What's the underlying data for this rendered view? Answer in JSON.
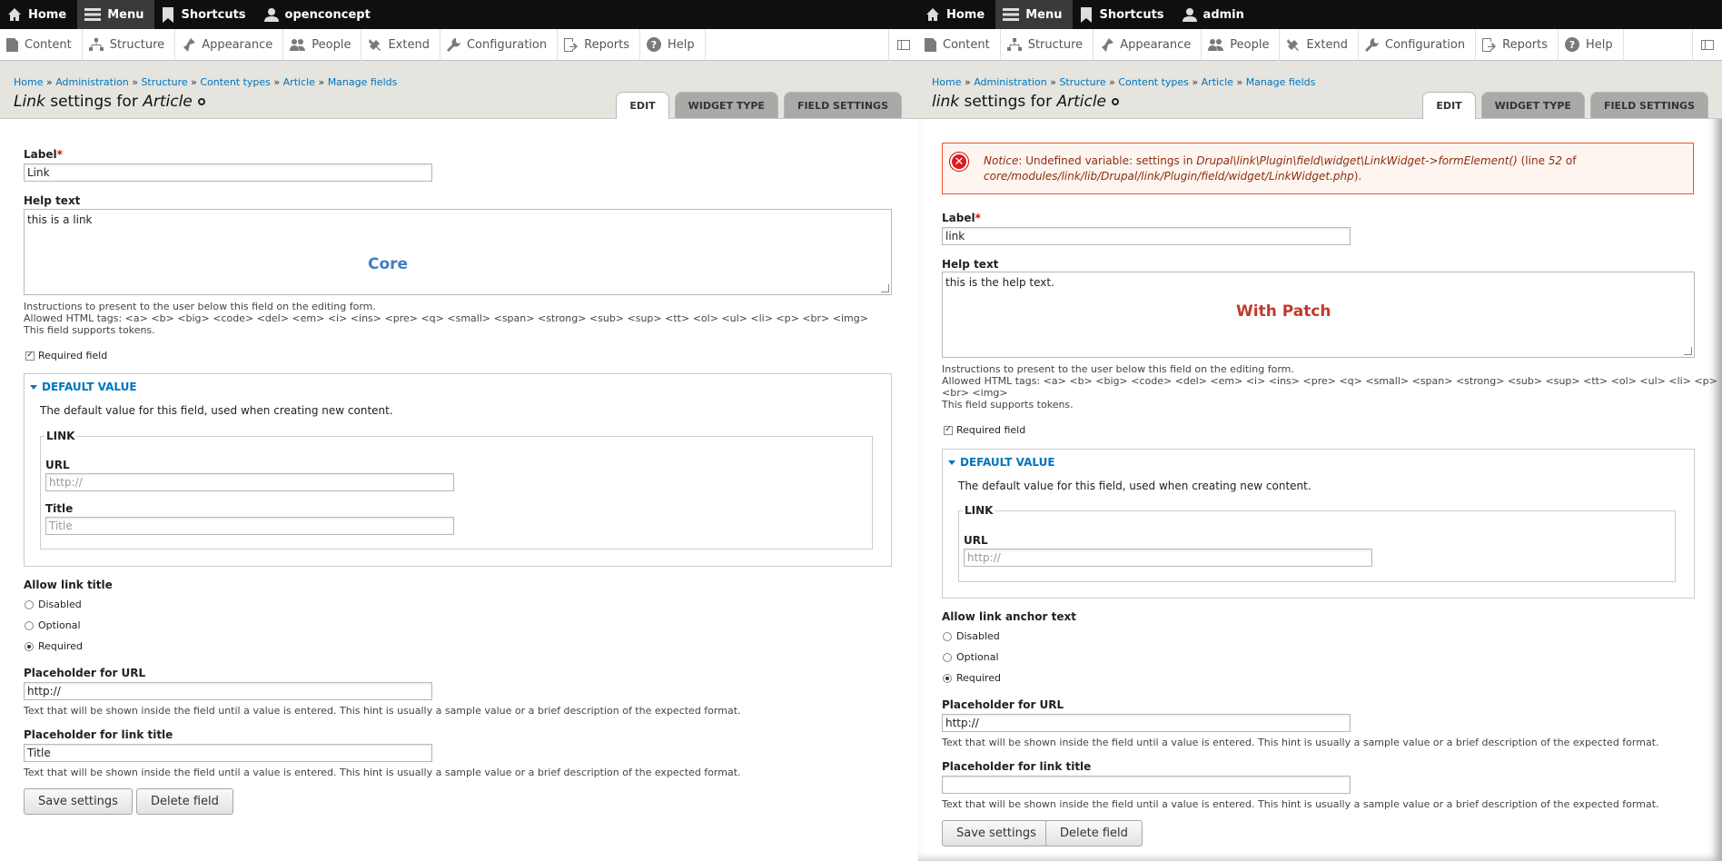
{
  "left": {
    "toolbar": {
      "home": "Home",
      "menu": "Menu",
      "shortcuts": "Shortcuts",
      "user": "openconcept"
    },
    "admin_menu": {
      "items": [
        "Content",
        "Structure",
        "Appearance",
        "People",
        "Extend",
        "Configuration",
        "Reports",
        "Help"
      ]
    },
    "breadcrumb": [
      "Home",
      "Administration",
      "Structure",
      "Content types",
      "Article",
      "Manage fields"
    ],
    "title": {
      "field": "Link",
      "mid": " settings for ",
      "bundle": "Article"
    },
    "tabs": [
      "Edit",
      "Widget type",
      "Field settings"
    ],
    "overlay_label": "Core",
    "form": {
      "label_label": "Label",
      "label_value": "Link",
      "help_label": "Help text",
      "help_value": "this is a link",
      "help_desc1": "Instructions to present to the user below this field on the editing form.",
      "help_desc2": "Allowed HTML tags: <a> <b> <big> <code> <del> <em> <i> <ins> <pre> <q> <small> <span> <strong> <sub> <sup> <tt> <ol> <ul> <li> <p> <br> <img>",
      "help_desc3": "This field supports tokens.",
      "required_label": "Required field",
      "default_title": "Default value",
      "default_desc": "The default value for this field, used when creating new content.",
      "link_legend": "Link",
      "url_label": "URL",
      "url_placeholder": "http://",
      "title_label": "Title",
      "title_placeholder": "Title",
      "allow_title_label": "Allow link title",
      "options": [
        "Disabled",
        "Optional",
        "Required"
      ],
      "selected": "Required",
      "ph_url_label": "Placeholder for URL",
      "ph_url_value": "http://",
      "ph_desc": "Text that will be shown inside the field until a value is entered. This hint is usually a sample value or a brief description of the expected format.",
      "ph_title_label": "Placeholder for link title",
      "ph_title_value": "Title",
      "save": "Save settings",
      "delete": "Delete field"
    }
  },
  "right": {
    "toolbar": {
      "home": "Home",
      "menu": "Menu",
      "shortcuts": "Shortcuts",
      "user": "admin"
    },
    "admin_menu": {
      "items": [
        "Content",
        "Structure",
        "Appearance",
        "People",
        "Extend",
        "Configuration",
        "Reports",
        "Help"
      ]
    },
    "breadcrumb": [
      "Home",
      "Administration",
      "Structure",
      "Content types",
      "Article",
      "Manage fields"
    ],
    "title": {
      "field": "link",
      "mid": " settings for ",
      "bundle": "Article"
    },
    "tabs": [
      "Edit",
      "Widget type",
      "Field settings"
    ],
    "overlay_label": "With Patch",
    "error": {
      "notice": "Notice",
      "msg1": ": Undefined variable: settings in ",
      "func": "Drupal\\link\\Plugin\\field\\widget\\LinkWidget->formElement()",
      "msg2": " (line ",
      "line": "52",
      "msg3": " of ",
      "file": "core/modules/link/lib/Drupal/link/Plugin/field/widget/LinkWidget.php",
      "msg4": ")."
    },
    "form": {
      "label_label": "Label",
      "label_value": "link",
      "help_label": "Help text",
      "help_value": "this is the help text.",
      "help_desc1": "Instructions to present to the user below this field on the editing form.",
      "help_desc2a": "Allowed HTML tags: <a> <b> <big> <code> <del> <em> <i> <ins> <pre> <q> <small> <span> <strong> <sub> <sup> <tt> <ol> <ul> <li> <p>",
      "help_desc2b": "<br> <img>",
      "help_desc3": "This field supports tokens.",
      "required_label": "Required field",
      "default_title": "Default value",
      "default_desc": "The default value for this field, used when creating new content.",
      "link_legend": "Link",
      "url_label": "URL",
      "url_placeholder": "http://",
      "allow_title_label": "Allow link anchor text",
      "options": [
        "Disabled",
        "Optional",
        "Required"
      ],
      "selected": "Required",
      "ph_url_label": "Placeholder for URL",
      "ph_url_value": "http://",
      "ph_desc": "Text that will be shown inside the field until a value is entered. This hint is usually a sample value or a brief description of the expected format.",
      "ph_title_label": "Placeholder for link title",
      "ph_title_value": "",
      "save": "Save settings",
      "delete": "Delete field"
    }
  },
  "colors": {
    "link": "#0074bd",
    "core": "#3f7ec2",
    "patch": "#c0392b",
    "error_border": "#ed541d",
    "error_text": "#8c2e0b"
  },
  "icons": [
    "home-icon",
    "menu-icon",
    "bookmark-icon",
    "user-icon",
    "content-icon",
    "structure-icon",
    "appearance-icon",
    "people-icon",
    "extend-icon",
    "configuration-icon",
    "reports-icon",
    "help-icon",
    "toolbar-toggle-icon",
    "error-icon"
  ]
}
